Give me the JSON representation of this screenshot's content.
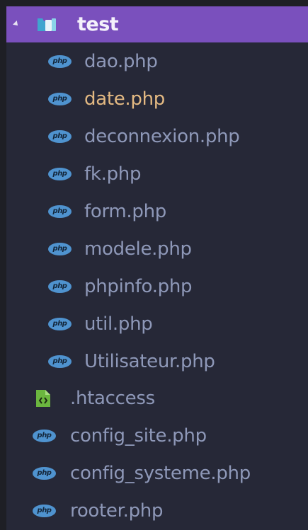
{
  "tree": {
    "folder": {
      "label": "test",
      "expanded": true,
      "icon": "folder-open-icon"
    },
    "children": [
      {
        "label": "dao.php",
        "icon": "php-file-icon",
        "active": false
      },
      {
        "label": "date.php",
        "icon": "php-file-icon",
        "active": true
      },
      {
        "label": "deconnexion.php",
        "icon": "php-file-icon",
        "active": false
      },
      {
        "label": "fk.php",
        "icon": "php-file-icon",
        "active": false
      },
      {
        "label": "form.php",
        "icon": "php-file-icon",
        "active": false
      },
      {
        "label": "modele.php",
        "icon": "php-file-icon",
        "active": false
      },
      {
        "label": "phpinfo.php",
        "icon": "php-file-icon",
        "active": false
      },
      {
        "label": "util.php",
        "icon": "php-file-icon",
        "active": false
      },
      {
        "label": "Utilisateur.php",
        "icon": "php-file-icon",
        "active": false
      }
    ],
    "root_files": [
      {
        "label": ".htaccess",
        "icon": "htaccess-file-icon"
      },
      {
        "label": "config_site.php",
        "icon": "php-file-icon"
      },
      {
        "label": "config_systeme.php",
        "icon": "php-file-icon"
      },
      {
        "label": "rooter.php",
        "icon": "php-file-icon"
      }
    ],
    "php_badge": "php"
  },
  "colors": {
    "selected_folder_bg": "#7a50bd",
    "panel_bg": "#262837",
    "file_text": "#8e98b8",
    "active_file_text": "#e3b982",
    "php_icon": "#4f93cf",
    "htaccess_icon": "#6bb63f"
  }
}
